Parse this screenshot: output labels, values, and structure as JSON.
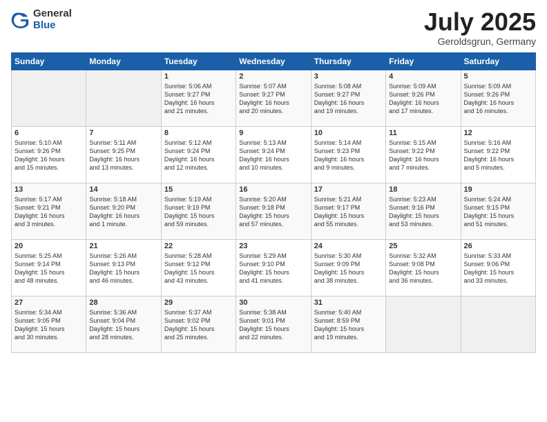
{
  "logo": {
    "general": "General",
    "blue": "Blue"
  },
  "title": "July 2025",
  "location": "Geroldsgrun, Germany",
  "headers": [
    "Sunday",
    "Monday",
    "Tuesday",
    "Wednesday",
    "Thursday",
    "Friday",
    "Saturday"
  ],
  "weeks": [
    [
      {
        "day": "",
        "info": ""
      },
      {
        "day": "",
        "info": ""
      },
      {
        "day": "1",
        "info": "Sunrise: 5:06 AM\nSunset: 9:27 PM\nDaylight: 16 hours\nand 21 minutes."
      },
      {
        "day": "2",
        "info": "Sunrise: 5:07 AM\nSunset: 9:27 PM\nDaylight: 16 hours\nand 20 minutes."
      },
      {
        "day": "3",
        "info": "Sunrise: 5:08 AM\nSunset: 9:27 PM\nDaylight: 16 hours\nand 19 minutes."
      },
      {
        "day": "4",
        "info": "Sunrise: 5:09 AM\nSunset: 9:26 PM\nDaylight: 16 hours\nand 17 minutes."
      },
      {
        "day": "5",
        "info": "Sunrise: 5:09 AM\nSunset: 9:26 PM\nDaylight: 16 hours\nand 16 minutes."
      }
    ],
    [
      {
        "day": "6",
        "info": "Sunrise: 5:10 AM\nSunset: 9:26 PM\nDaylight: 16 hours\nand 15 minutes."
      },
      {
        "day": "7",
        "info": "Sunrise: 5:11 AM\nSunset: 9:25 PM\nDaylight: 16 hours\nand 13 minutes."
      },
      {
        "day": "8",
        "info": "Sunrise: 5:12 AM\nSunset: 9:24 PM\nDaylight: 16 hours\nand 12 minutes."
      },
      {
        "day": "9",
        "info": "Sunrise: 5:13 AM\nSunset: 9:24 PM\nDaylight: 16 hours\nand 10 minutes."
      },
      {
        "day": "10",
        "info": "Sunrise: 5:14 AM\nSunset: 9:23 PM\nDaylight: 16 hours\nand 9 minutes."
      },
      {
        "day": "11",
        "info": "Sunrise: 5:15 AM\nSunset: 9:22 PM\nDaylight: 16 hours\nand 7 minutes."
      },
      {
        "day": "12",
        "info": "Sunrise: 5:16 AM\nSunset: 9:22 PM\nDaylight: 16 hours\nand 5 minutes."
      }
    ],
    [
      {
        "day": "13",
        "info": "Sunrise: 5:17 AM\nSunset: 9:21 PM\nDaylight: 16 hours\nand 3 minutes."
      },
      {
        "day": "14",
        "info": "Sunrise: 5:18 AM\nSunset: 9:20 PM\nDaylight: 16 hours\nand 1 minute."
      },
      {
        "day": "15",
        "info": "Sunrise: 5:19 AM\nSunset: 9:19 PM\nDaylight: 15 hours\nand 59 minutes."
      },
      {
        "day": "16",
        "info": "Sunrise: 5:20 AM\nSunset: 9:18 PM\nDaylight: 15 hours\nand 57 minutes."
      },
      {
        "day": "17",
        "info": "Sunrise: 5:21 AM\nSunset: 9:17 PM\nDaylight: 15 hours\nand 55 minutes."
      },
      {
        "day": "18",
        "info": "Sunrise: 5:23 AM\nSunset: 9:16 PM\nDaylight: 15 hours\nand 53 minutes."
      },
      {
        "day": "19",
        "info": "Sunrise: 5:24 AM\nSunset: 9:15 PM\nDaylight: 15 hours\nand 51 minutes."
      }
    ],
    [
      {
        "day": "20",
        "info": "Sunrise: 5:25 AM\nSunset: 9:14 PM\nDaylight: 15 hours\nand 48 minutes."
      },
      {
        "day": "21",
        "info": "Sunrise: 5:26 AM\nSunset: 9:13 PM\nDaylight: 15 hours\nand 46 minutes."
      },
      {
        "day": "22",
        "info": "Sunrise: 5:28 AM\nSunset: 9:12 PM\nDaylight: 15 hours\nand 43 minutes."
      },
      {
        "day": "23",
        "info": "Sunrise: 5:29 AM\nSunset: 9:10 PM\nDaylight: 15 hours\nand 41 minutes."
      },
      {
        "day": "24",
        "info": "Sunrise: 5:30 AM\nSunset: 9:09 PM\nDaylight: 15 hours\nand 38 minutes."
      },
      {
        "day": "25",
        "info": "Sunrise: 5:32 AM\nSunset: 9:08 PM\nDaylight: 15 hours\nand 36 minutes."
      },
      {
        "day": "26",
        "info": "Sunrise: 5:33 AM\nSunset: 9:06 PM\nDaylight: 15 hours\nand 33 minutes."
      }
    ],
    [
      {
        "day": "27",
        "info": "Sunrise: 5:34 AM\nSunset: 9:05 PM\nDaylight: 15 hours\nand 30 minutes."
      },
      {
        "day": "28",
        "info": "Sunrise: 5:36 AM\nSunset: 9:04 PM\nDaylight: 15 hours\nand 28 minutes."
      },
      {
        "day": "29",
        "info": "Sunrise: 5:37 AM\nSunset: 9:02 PM\nDaylight: 15 hours\nand 25 minutes."
      },
      {
        "day": "30",
        "info": "Sunrise: 5:38 AM\nSunset: 9:01 PM\nDaylight: 15 hours\nand 22 minutes."
      },
      {
        "day": "31",
        "info": "Sunrise: 5:40 AM\nSunset: 8:59 PM\nDaylight: 15 hours\nand 19 minutes."
      },
      {
        "day": "",
        "info": ""
      },
      {
        "day": "",
        "info": ""
      }
    ]
  ]
}
